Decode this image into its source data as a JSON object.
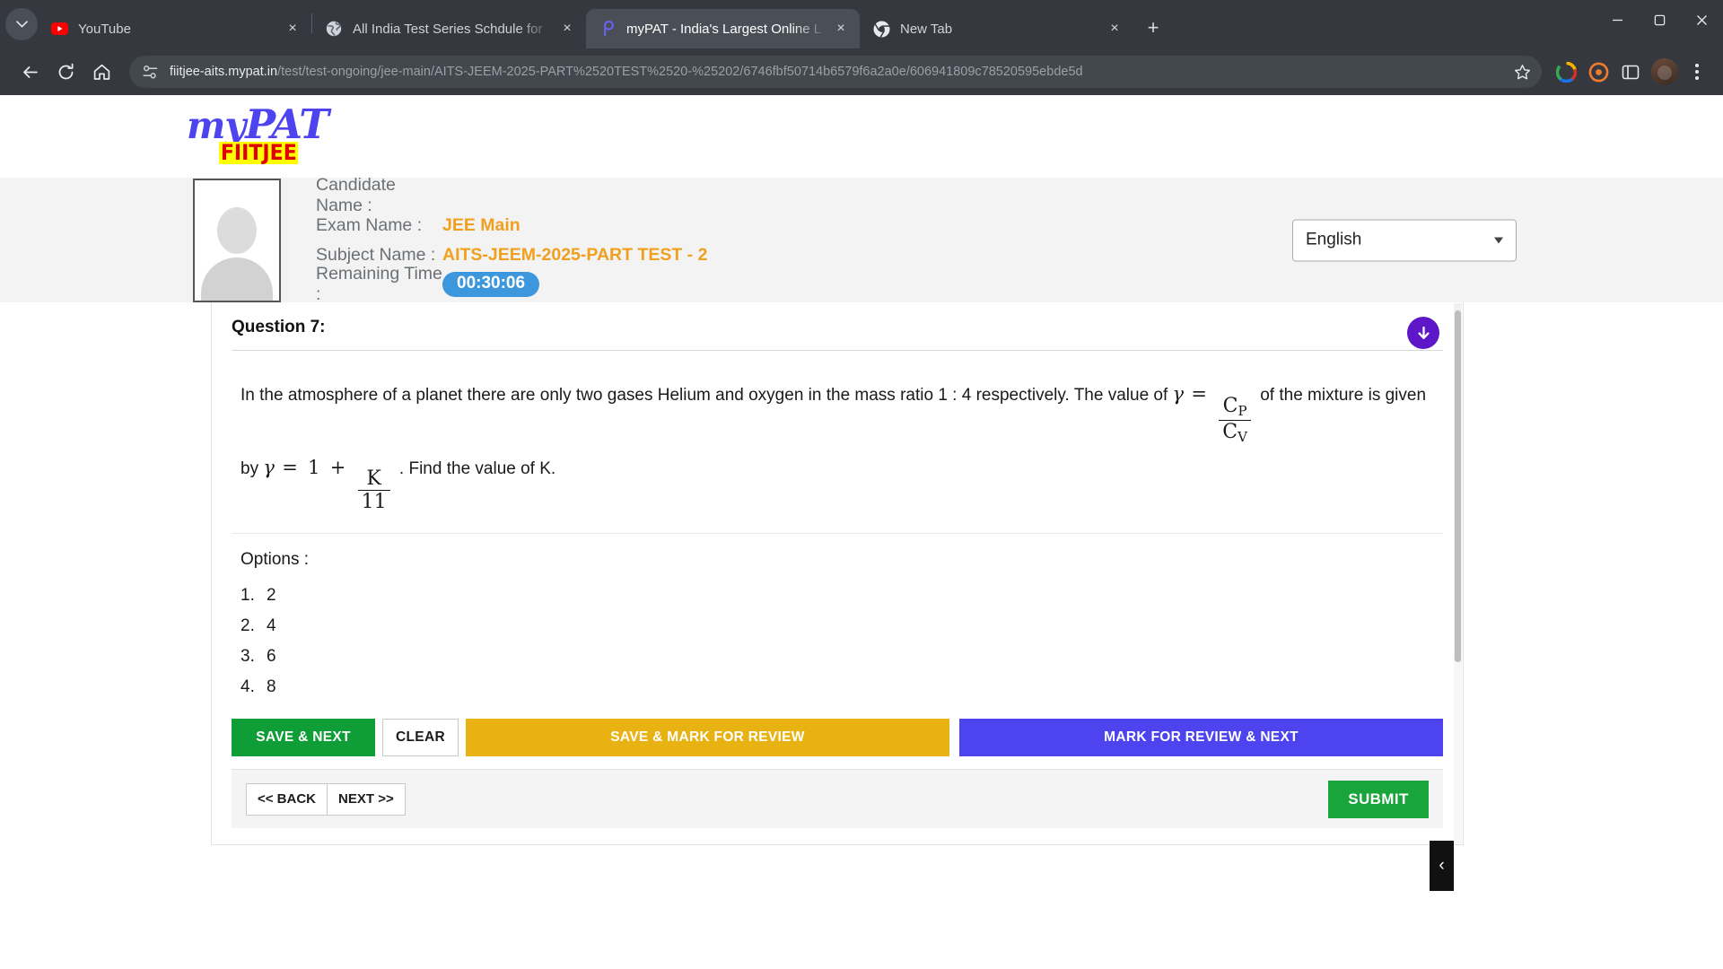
{
  "browser": {
    "tabs": [
      {
        "title": "YouTube",
        "favicon": "youtube-icon",
        "active": false
      },
      {
        "title": "All India Test Series Schdule for",
        "favicon": "globe-icon",
        "active": false
      },
      {
        "title": "myPAT - India's Largest Online L",
        "favicon": "mypat-icon",
        "active": true
      },
      {
        "title": "New Tab",
        "favicon": "chrome-icon",
        "active": false
      }
    ],
    "new_tab_label": "+",
    "close_label": "×",
    "window_controls": {
      "minimize": "─",
      "maximize": "☐",
      "close": "✕"
    },
    "omnibox": {
      "domain": "fiitjee-aits.mypat.in",
      "path": "/test/test-ongoing/jee-main/AITS-JEEM-2025-PART%2520TEST%2520-%25202/6746fbf50714b6579f6a2a0e/606941809c78520595ebde5d"
    }
  },
  "site": {
    "logo": {
      "my": "my",
      "pat": "PAT",
      "fiitjee": "FIITJEE"
    },
    "candidate": {
      "rows": [
        {
          "label": "Candidate Name :",
          "value": ""
        },
        {
          "label": "Exam Name :",
          "value": "JEE Main"
        },
        {
          "label": "Subject Name :",
          "value": "AITS-JEEM-2025-PART TEST - 2"
        }
      ],
      "time_label": "Remaining Time :",
      "time_value": "00:30:06"
    },
    "language": {
      "selected": "English"
    }
  },
  "question": {
    "heading": "Question 7:",
    "text_part1": "In the atmosphere of a planet there are only two gases Helium and oxygen in the mass ratio 1 : 4 respectively. The value of",
    "gamma1": "γ",
    "equals1": "=",
    "frac1_num": "C",
    "frac1_num_sub": "P",
    "frac1_den": "C",
    "frac1_den_sub": "V",
    "text_part2": "of the mixture is given by",
    "gamma2": "γ",
    "equals2": "=",
    "one": "1",
    "plus": "+",
    "frac2_num": "K",
    "frac2_den": "11",
    "text_part3": ". Find the value of K.",
    "options_label": "Options :",
    "options": [
      {
        "num": "1.",
        "text": "2"
      },
      {
        "num": "2.",
        "text": "4"
      },
      {
        "num": "3.",
        "text": "6"
      },
      {
        "num": "4.",
        "text": "8"
      }
    ]
  },
  "actions": {
    "save_next": "SAVE & NEXT",
    "clear": "CLEAR",
    "save_mark_review": "SAVE & MARK FOR REVIEW",
    "mark_review_next": "MARK FOR REVIEW & NEXT",
    "back": "<< BACK",
    "next": "NEXT >>",
    "submit": "SUBMIT",
    "panel_toggle": "‹"
  },
  "colors": {
    "brand_purple": "#4d43ef",
    "accent_orange": "#f0a01e",
    "timer_blue": "#3c97dc",
    "green": "#0f9d38",
    "yellow": "#e8b312",
    "submit_green": "#1aa53c"
  }
}
